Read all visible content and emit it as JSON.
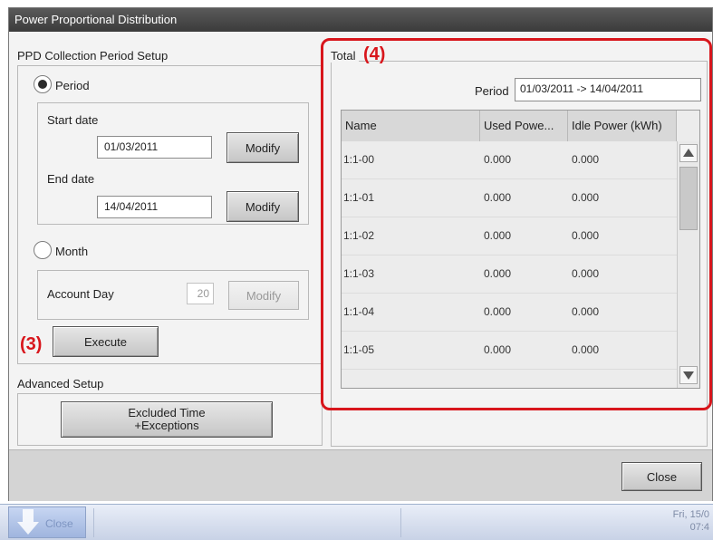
{
  "window": {
    "title": "Power Proportional Distribution"
  },
  "setup": {
    "heading": "PPD Collection Period Setup",
    "period_label": "Period",
    "start_label": "Start date",
    "start_value": "01/03/2011",
    "end_label": "End date",
    "end_value": "14/04/2011",
    "modify_label": "Modify",
    "month_label": "Month",
    "account_label": "Account Day",
    "account_value": "20",
    "execute_label": "Execute"
  },
  "advanced": {
    "heading": "Advanced Setup",
    "excluded_line1": "Excluded Time",
    "excluded_line2": "+Exceptions"
  },
  "total": {
    "heading": "Total",
    "period_label": "Period",
    "period_value": "01/03/2011 -> 14/04/2011",
    "columns": [
      "Name",
      "Used Powe...",
      "Idle Power (kWh)"
    ],
    "rows": [
      [
        "1:1-00",
        "0.000",
        "0.000"
      ],
      [
        "1:1-01",
        "0.000",
        "0.000"
      ],
      [
        "1:1-02",
        "0.000",
        "0.000"
      ],
      [
        "1:1-03",
        "0.000",
        "0.000"
      ],
      [
        "1:1-04",
        "0.000",
        "0.000"
      ],
      [
        "1:1-05",
        "0.000",
        "0.000"
      ]
    ]
  },
  "annotations": {
    "execute_callout": "(3)",
    "total_callout": "(4)"
  },
  "footer": {
    "close_label": "Close"
  },
  "taskbar": {
    "date": "Fri, 15/0",
    "time": "07:4",
    "button_label": "Close"
  },
  "colors": {
    "callout_red": "#d8161c",
    "titlebar": "#3b3b3b"
  }
}
